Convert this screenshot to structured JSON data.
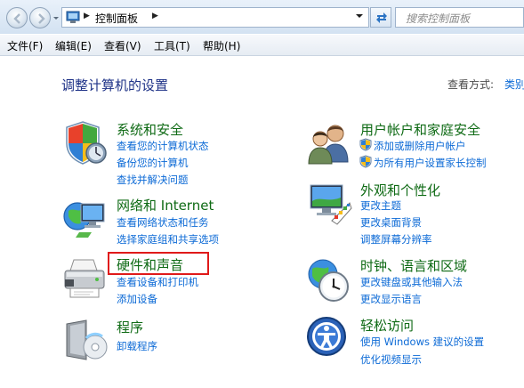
{
  "address_bar": {
    "breadcrumb": [
      "控制面板"
    ],
    "search_placeholder": "搜索控制面板"
  },
  "menu": [
    "文件(F)",
    "编辑(E)",
    "查看(V)",
    "工具(T)",
    "帮助(H)"
  ],
  "page": {
    "title": "调整计算机的设置",
    "view_by_label": "查看方式:",
    "view_by_value": "类别"
  },
  "categories": [
    {
      "title": "系统和安全",
      "icon": "shield-icon",
      "links": [
        "查看您的计算机状态",
        "备份您的计算机",
        "查找并解决问题"
      ]
    },
    {
      "title": "网络和 Internet",
      "icon": "network-globe-icon",
      "links": [
        "查看网络状态和任务",
        "选择家庭组和共享选项"
      ]
    },
    {
      "title": "硬件和声音",
      "icon": "printer-icon",
      "links": [
        "查看设备和打印机",
        "添加设备"
      ]
    },
    {
      "title": "程序",
      "icon": "programs-icon",
      "links": [
        "卸载程序"
      ]
    },
    {
      "title": "用户帐户和家庭安全",
      "icon": "users-icon",
      "links": [
        "添加或删除用户帐户",
        "为所有用户设置家长控制"
      ]
    },
    {
      "title": "外观和个性化",
      "icon": "monitor-palette-icon",
      "links": [
        "更改主题",
        "更改桌面背景",
        "调整屏幕分辨率"
      ]
    },
    {
      "title": "时钟、语言和区域",
      "icon": "clock-globe-icon",
      "links": [
        "更改键盘或其他输入法",
        "更改显示语言"
      ]
    },
    {
      "title": "轻松访问",
      "icon": "ease-of-access-icon",
      "links": [
        "使用 Windows 建议的设置",
        "优化视频显示"
      ]
    }
  ],
  "highlight": {
    "target": "硬件和声音",
    "color": "#e01a1a"
  },
  "colors": {
    "category_title": "#0e6a14",
    "link": "#0c6ad6",
    "heading": "#1e3287"
  }
}
